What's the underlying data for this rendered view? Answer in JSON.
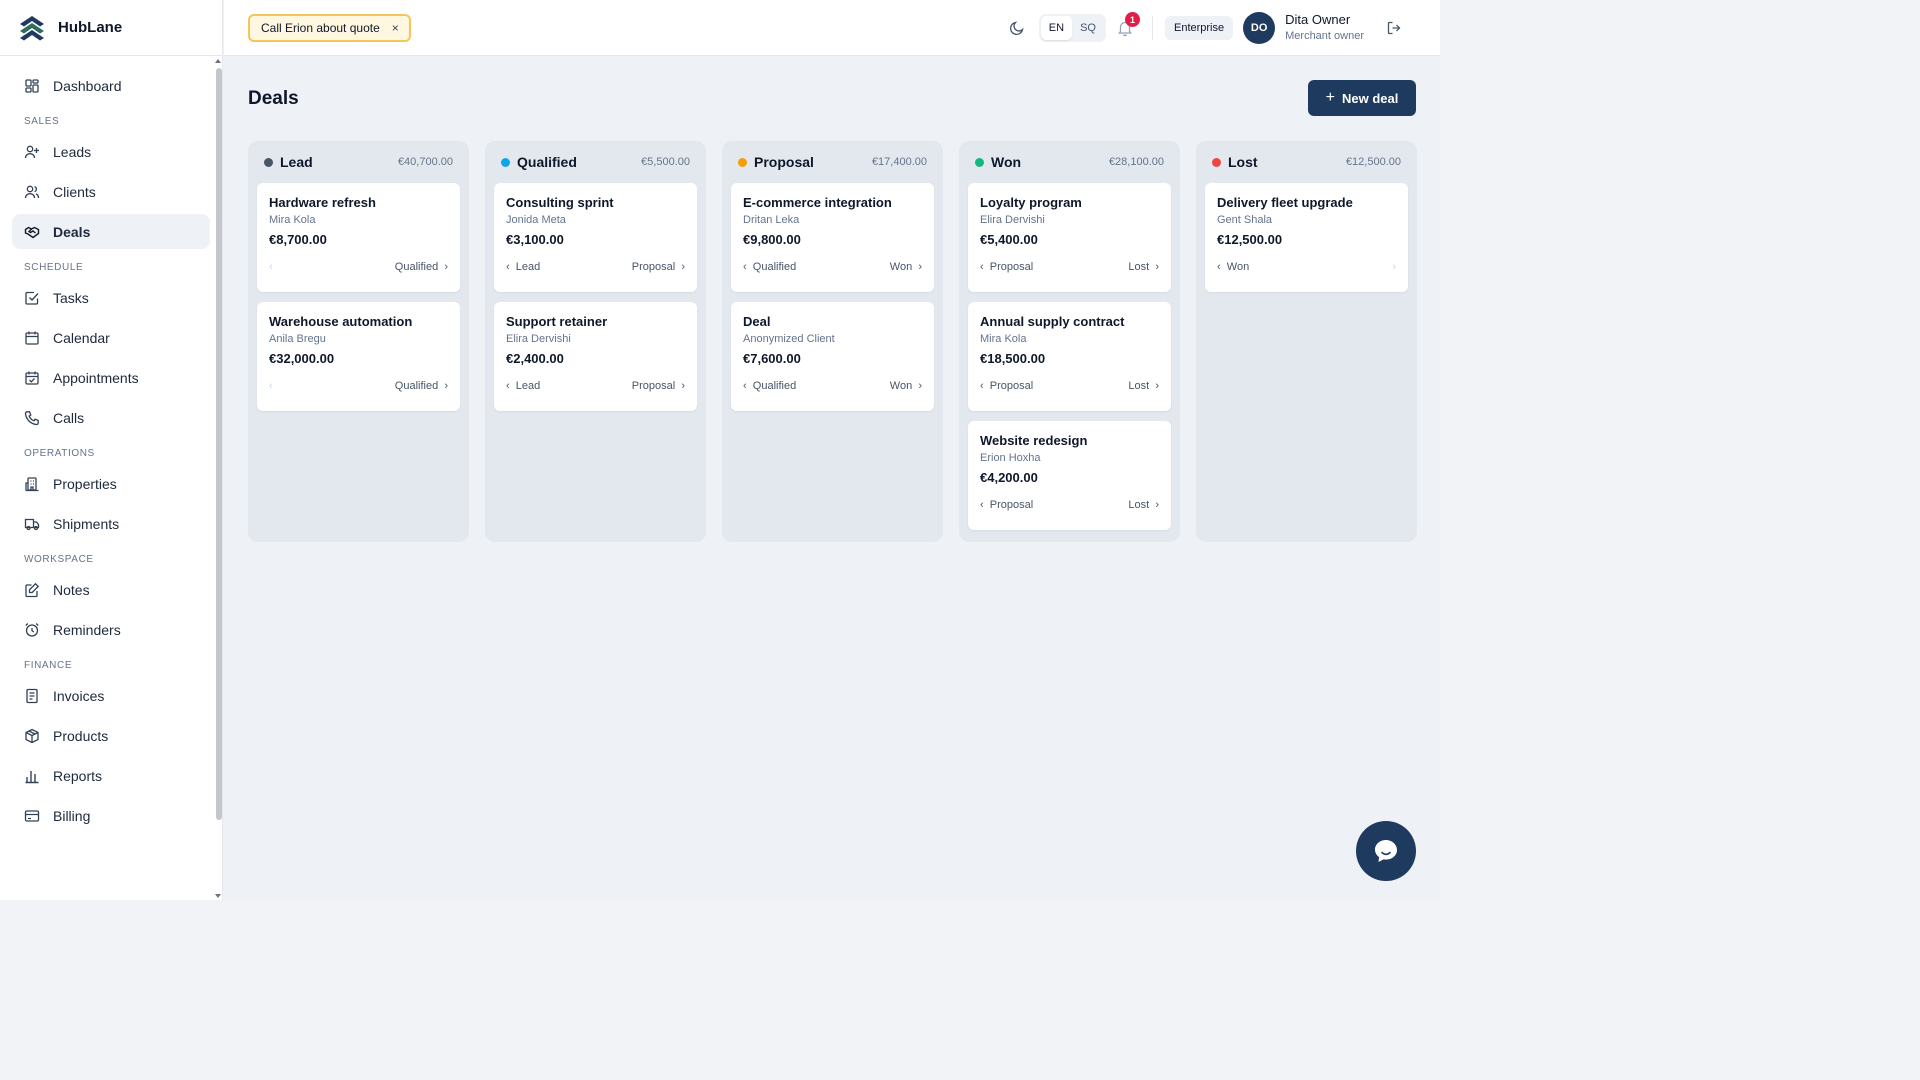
{
  "brand": {
    "name": "HubLane"
  },
  "sidebar": {
    "dashboard": "Dashboard",
    "sections": {
      "sales": "SALES",
      "schedule": "SCHEDULE",
      "operations": "OPERATIONS",
      "workspace": "WORKSPACE",
      "finance": "FINANCE"
    },
    "items": {
      "leads": "Leads",
      "clients": "Clients",
      "deals": "Deals",
      "tasks": "Tasks",
      "calendar": "Calendar",
      "appointments": "Appointments",
      "calls": "Calls",
      "properties": "Properties",
      "shipments": "Shipments",
      "notes": "Notes",
      "reminders": "Reminders",
      "invoices": "Invoices",
      "products": "Products",
      "reports": "Reports",
      "billing": "Billing"
    }
  },
  "header": {
    "reminder": "Call Erion about quote",
    "reminder_close": "×",
    "lang_en": "EN",
    "lang_sq": "SQ",
    "notifications": "1",
    "plan": "Enterprise",
    "avatar_initials": "DO",
    "user_name": "Dita Owner",
    "user_role": "Merchant owner"
  },
  "main": {
    "title": "Deals",
    "new_deal": "New deal",
    "plus": "+"
  },
  "colors": {
    "primary": "#1e3a5f",
    "lead": "#475569",
    "qualified": "#0ea5e9",
    "proposal": "#f59e0b",
    "won": "#10b981",
    "lost": "#ef4444"
  },
  "columns": [
    {
      "title": "Lead",
      "total": "€40,700.00",
      "cards": [
        {
          "title": "Hardware refresh",
          "client": "Mira Kola",
          "amount": "€8,700.00",
          "prev": "",
          "next": "Qualified"
        },
        {
          "title": "Warehouse automation",
          "client": "Anila Bregu",
          "amount": "€32,000.00",
          "prev": "",
          "next": "Qualified"
        }
      ]
    },
    {
      "title": "Qualified",
      "total": "€5,500.00",
      "cards": [
        {
          "title": "Consulting sprint",
          "client": "Jonida Meta",
          "amount": "€3,100.00",
          "prev": "Lead",
          "next": "Proposal"
        },
        {
          "title": "Support retainer",
          "client": "Elira Dervishi",
          "amount": "€2,400.00",
          "prev": "Lead",
          "next": "Proposal"
        }
      ]
    },
    {
      "title": "Proposal",
      "total": "€17,400.00",
      "cards": [
        {
          "title": "E-commerce integration",
          "client": "Dritan Leka",
          "amount": "€9,800.00",
          "prev": "Qualified",
          "next": "Won"
        },
        {
          "title": "Deal",
          "client": "Anonymized Client",
          "amount": "€7,600.00",
          "prev": "Qualified",
          "next": "Won"
        }
      ]
    },
    {
      "title": "Won",
      "total": "€28,100.00",
      "cards": [
        {
          "title": "Loyalty program",
          "client": "Elira Dervishi",
          "amount": "€5,400.00",
          "prev": "Proposal",
          "next": "Lost"
        },
        {
          "title": "Annual supply contract",
          "client": "Mira Kola",
          "amount": "€18,500.00",
          "prev": "Proposal",
          "next": "Lost"
        },
        {
          "title": "Website redesign",
          "client": "Erion Hoxha",
          "amount": "€4,200.00",
          "prev": "Proposal",
          "next": "Lost"
        }
      ]
    },
    {
      "title": "Lost",
      "total": "€12,500.00",
      "cards": [
        {
          "title": "Delivery fleet upgrade",
          "client": "Gent Shala",
          "amount": "€12,500.00",
          "prev": "Won",
          "next": ""
        }
      ]
    }
  ]
}
